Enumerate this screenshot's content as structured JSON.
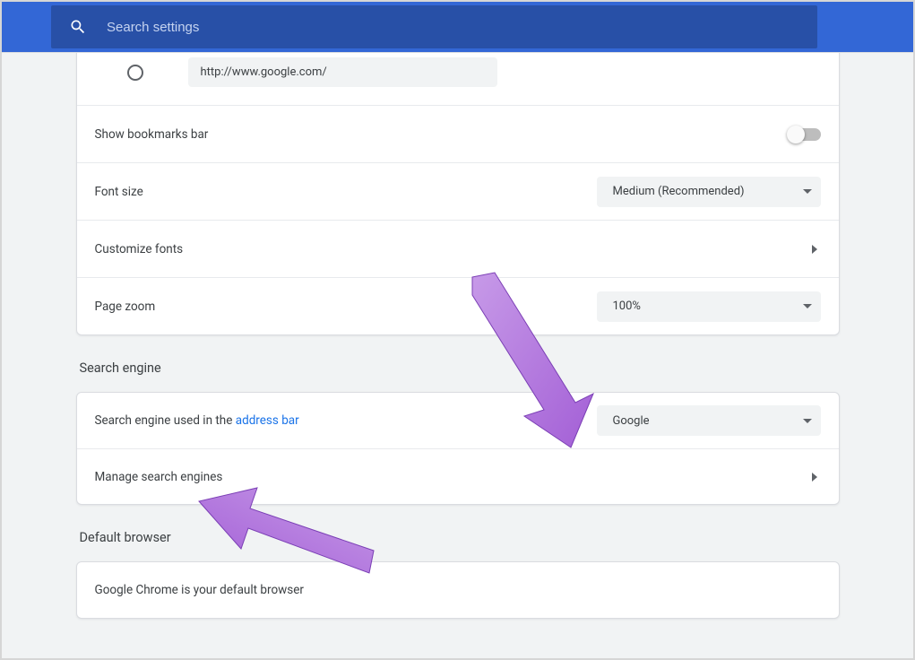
{
  "search": {
    "placeholder": "Search settings"
  },
  "appearance": {
    "homepage_url": "http://www.google.com/",
    "bookmarks_bar_label": "Show bookmarks bar",
    "bookmarks_bar_on": false,
    "font_size_label": "Font size",
    "font_size_value": "Medium (Recommended)",
    "customize_fonts_label": "Customize fonts",
    "page_zoom_label": "Page zoom",
    "page_zoom_value": "100%"
  },
  "search_engine": {
    "section_title": "Search engine",
    "used_in_label_prefix": "Search engine used in the ",
    "used_in_link": "address bar",
    "engine_value": "Google",
    "manage_label": "Manage search engines"
  },
  "default_browser": {
    "section_title": "Default browser",
    "status": "Google Chrome is your default browser"
  },
  "annotation": {
    "arrow_color": "#b57be6"
  }
}
